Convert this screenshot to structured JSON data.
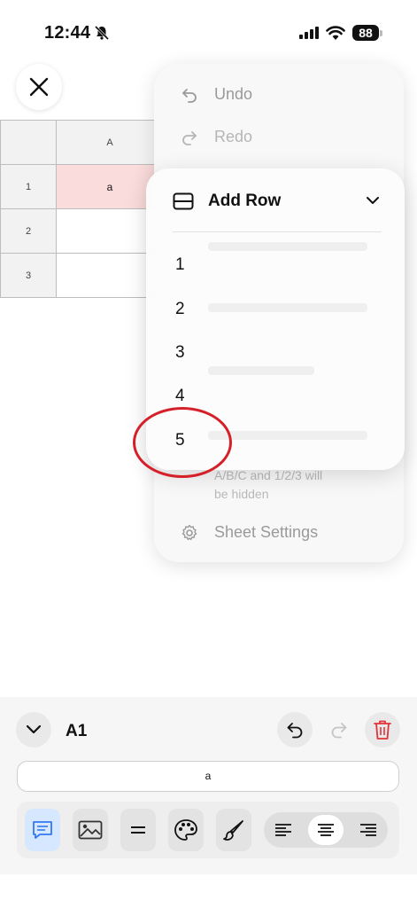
{
  "status": {
    "time": "12:44",
    "battery": "88"
  },
  "grid": {
    "col_header": "A",
    "rows": [
      {
        "num": "1",
        "value": "a"
      },
      {
        "num": "2",
        "value": ""
      },
      {
        "num": "3",
        "value": ""
      }
    ]
  },
  "menu": {
    "undo": "Undo",
    "redo": "Redo",
    "hidden_note_1": "A/B/C and 1/2/3 will",
    "hidden_note_2": "be hidden",
    "sheet_settings": "Sheet Settings"
  },
  "add_row": {
    "title": "Add Row",
    "options": [
      "1",
      "2",
      "3",
      "4",
      "5"
    ]
  },
  "editor": {
    "cell_ref": "A1",
    "formula_value": "a"
  },
  "colors": {
    "selected_cell": "#fadcdc",
    "highlight_circle": "#d5202a",
    "delete_red": "#e0343a",
    "active_tool": "#d6e8ff",
    "comment_blue": "#3478f6"
  }
}
